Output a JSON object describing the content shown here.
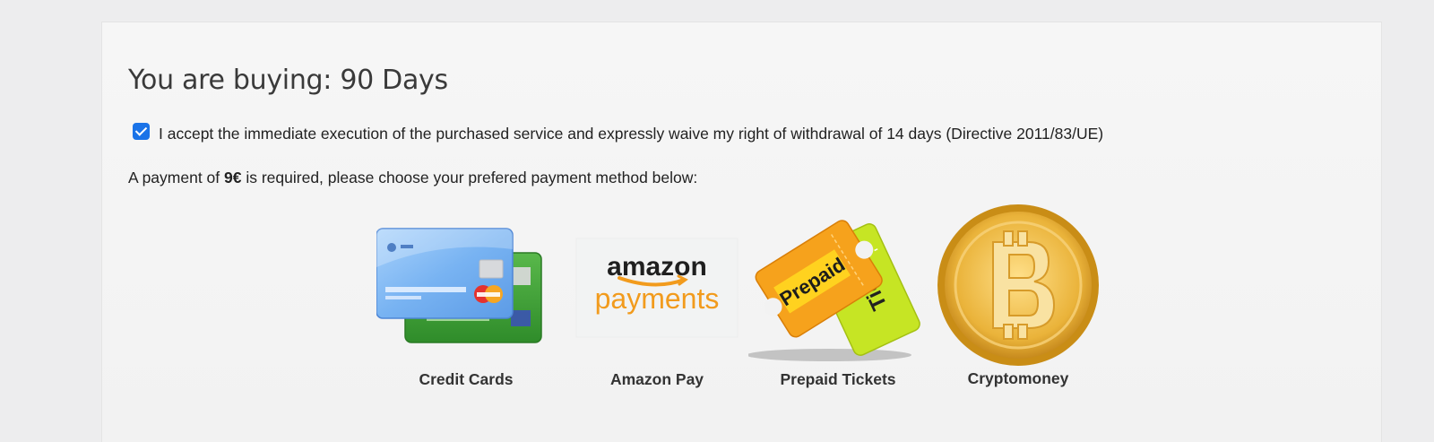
{
  "page": {
    "title": "You are buying: 90 Days",
    "consent": {
      "checked": true,
      "text": "I accept the immediate execution of the purchased service and expressly waive my right of withdrawal of 14 days (Directive 2011/83/UE)"
    },
    "payment": {
      "prefix": "A payment of ",
      "amount": "9€",
      "suffix": " is required, please choose your prefered payment method below:"
    }
  },
  "methods": [
    {
      "label": "Credit Cards",
      "icon": "credit-cards-icon"
    },
    {
      "label": "Amazon Pay",
      "icon": "amazon-payments-logo",
      "logo_text_top": "amazon",
      "logo_text_bottom": "payments"
    },
    {
      "label": "Prepaid Tickets",
      "icon": "prepaid-tickets-icon",
      "ticket_text_front": "Prepaid",
      "ticket_text_back": "Tick"
    },
    {
      "label": "Cryptomoney",
      "icon": "bitcoin-icon"
    }
  ],
  "colors": {
    "background": "#ededee",
    "panel": "#f4f4f4",
    "checkbox": "#1a73e8",
    "amazon_orange": "#f29b1d",
    "bitcoin_gold": "#e0a523"
  }
}
